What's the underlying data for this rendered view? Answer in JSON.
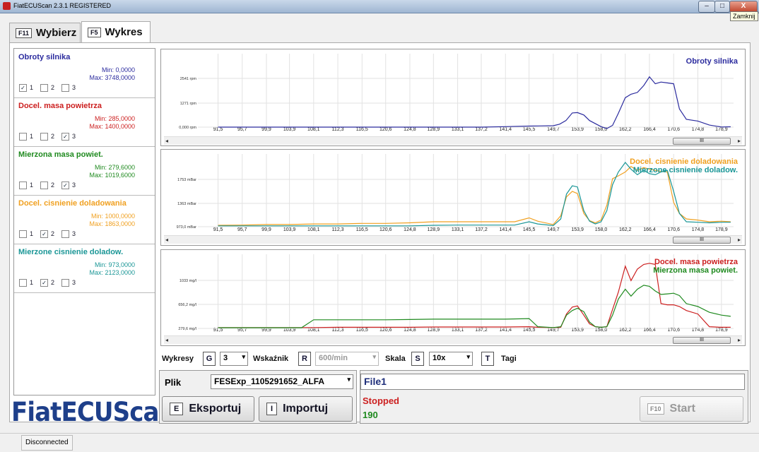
{
  "window": {
    "title": "FiatECUScan 2.3.1 REGISTERED",
    "close_tooltip": "Zamknij",
    "min_label": "–",
    "max_label": "□",
    "close_label": "X"
  },
  "tabs": [
    {
      "key": "F11",
      "label": "Wybierz"
    },
    {
      "key": "F5",
      "label": "Wykres"
    }
  ],
  "signals": [
    {
      "name": "Obroty silnika",
      "color": "#2b2b9e",
      "min": "Min: 0,0000",
      "max": "Max: 3748,0000",
      "checked": [
        true,
        false,
        false
      ]
    },
    {
      "name": "Docel. masa powietrza",
      "color": "#cc1f1f",
      "min": "Min: 285,0000",
      "max": "Max: 1400,0000",
      "checked": [
        false,
        false,
        true
      ]
    },
    {
      "name": "Mierzona masa powiet.",
      "color": "#1f8a1f",
      "min": "Min: 279,6000",
      "max": "Max: 1019,6000",
      "checked": [
        false,
        false,
        true
      ]
    },
    {
      "name": "Docel. cisnienie doladowania",
      "color": "#f0a020",
      "min": "Min: 1000,0000",
      "max": "Max: 1863,0000",
      "checked": [
        false,
        true,
        false
      ]
    },
    {
      "name": "Mierzone cisnienie doladow.",
      "color": "#1a9696",
      "min": "Min: 973,0000",
      "max": "Max: 2123,0000",
      "checked": [
        false,
        true,
        false
      ]
    }
  ],
  "check_labels": [
    "1",
    "2",
    "3"
  ],
  "check_mark": "✓",
  "x_ticks": [
    "91,5",
    "95,7",
    "99,9",
    "103,9",
    "108,1",
    "112,3",
    "116,5",
    "120,6",
    "124,8",
    "128,9",
    "133,1",
    "137,2",
    "141,4",
    "145,5",
    "149,7",
    "153,9",
    "158,0",
    "162,2",
    "166,4",
    "170,6",
    "174,8",
    "178,9"
  ],
  "scroll": {
    "left": "◂",
    "right": "▸",
    "thumb": "III"
  },
  "chart_data": [
    {
      "type": "line",
      "y_ticks": [
        "2541 rpm",
        "1271 rpm",
        "0,000 rpm"
      ],
      "x": [
        91.5,
        95.7,
        99.9,
        103.9,
        108.1,
        112.3,
        116.5,
        120.6,
        124.8,
        128.9,
        133.1,
        137.2,
        141.4,
        145.5,
        149.7,
        150.8,
        151.9,
        153.0,
        153.9,
        155.0,
        156.0,
        158.0,
        159.0,
        160.0,
        161.0,
        162.2,
        163.2,
        164.3,
        165.4,
        166.4,
        167.4,
        168.4,
        169.5,
        170.6,
        171.6,
        172.8,
        174.8,
        176.8,
        178.9,
        180.5
      ],
      "series": [
        {
          "name": "Obroty silnika",
          "color": "#2b2b9e",
          "values": [
            0,
            0,
            0,
            0,
            0,
            0,
            0,
            0,
            0,
            0,
            0,
            0,
            30,
            60,
            80,
            170,
            380,
            820,
            840,
            700,
            380,
            30,
            -80,
            100,
            800,
            1700,
            1900,
            2000,
            2400,
            2900,
            2500,
            2600,
            2550,
            2500,
            1050,
            450,
            350,
            120,
            10,
            20
          ]
        }
      ]
    },
    {
      "type": "line",
      "y_ticks": [
        "1753 mBar",
        "1363 mBar",
        "973,0 mBar"
      ],
      "x": [
        91.5,
        95.7,
        99.9,
        103.9,
        108.1,
        112.3,
        116.5,
        120.6,
        124.8,
        128.9,
        133.1,
        137.2,
        141.4,
        143.0,
        145.5,
        147.0,
        149.7,
        151.0,
        152.0,
        153.0,
        153.9,
        155.0,
        156.0,
        157.0,
        158.0,
        159.0,
        160.0,
        161.0,
        162.2,
        163.2,
        164.3,
        165.4,
        166.4,
        167.4,
        168.4,
        169.5,
        170.6,
        171.6,
        172.8,
        174.8,
        176.8,
        178.9,
        180.5
      ],
      "series": [
        {
          "name": "Docel. cisnienie doladowania",
          "color": "#f0a020",
          "values": [
            985,
            990,
            1000,
            1000,
            1010,
            1010,
            1020,
            1020,
            1030,
            1050,
            1050,
            1050,
            1050,
            1050,
            1120,
            1060,
            1000,
            1160,
            1500,
            1600,
            1560,
            1200,
            1070,
            1030,
            1080,
            1350,
            1830,
            1880,
            1950,
            2050,
            1980,
            2030,
            2000,
            1980,
            1960,
            1950,
            1400,
            1200,
            1100,
            1080,
            1050,
            1060,
            1050
          ]
        },
        {
          "name": "Mierzone cisnienie doladow.",
          "color": "#1a9696",
          "values": [
            975,
            975,
            975,
            975,
            975,
            975,
            975,
            975,
            975,
            985,
            990,
            990,
            990,
            990,
            1050,
            1010,
            980,
            1100,
            1550,
            1700,
            1680,
            1250,
            1060,
            1010,
            1050,
            1250,
            1720,
            1950,
            2123,
            2000,
            1900,
            1980,
            1920,
            1900,
            1950,
            1980,
            1600,
            1200,
            1050,
            1040,
            1030,
            1040,
            1040
          ]
        }
      ]
    },
    {
      "type": "line",
      "y_ticks": [
        "1033 mg/l",
        "656,2 mg/l",
        "279,6 mg/l"
      ],
      "x": [
        91.5,
        95.7,
        99.9,
        103.9,
        106.0,
        108.1,
        112.3,
        116.5,
        120.6,
        124.8,
        128.9,
        133.1,
        137.2,
        141.4,
        145.5,
        147.0,
        149.7,
        151.0,
        152.0,
        153.0,
        153.9,
        155.0,
        156.0,
        157.0,
        158.0,
        159.0,
        160.0,
        161.0,
        162.2,
        163.2,
        164.3,
        165.4,
        166.4,
        167.4,
        168.4,
        169.5,
        170.6,
        171.6,
        172.8,
        174.8,
        176.8,
        178.9,
        180.5
      ],
      "series": [
        {
          "name": "Docel. masa powietrza",
          "color": "#cc1f1f",
          "values": [
            285,
            285,
            285,
            285,
            285,
            285,
            290,
            290,
            290,
            290,
            295,
            295,
            295,
            295,
            300,
            290,
            285,
            290,
            520,
            640,
            660,
            500,
            350,
            300,
            290,
            300,
            600,
            900,
            1350,
            1100,
            1300,
            1380,
            1400,
            1380,
            700,
            680,
            680,
            650,
            580,
            520,
            300,
            290,
            290
          ]
        },
        {
          "name": "Mierzona masa powiet.",
          "color": "#1f8a1f",
          "values": [
            282,
            282,
            282,
            282,
            282,
            420,
            420,
            420,
            420,
            425,
            430,
            430,
            430,
            430,
            440,
            300,
            285,
            300,
            500,
            580,
            620,
            560,
            380,
            300,
            290,
            300,
            500,
            780,
            950,
            830,
            950,
            1019,
            1000,
            920,
            860,
            870,
            880,
            840,
            700,
            650,
            550,
            500,
            480
          ]
        }
      ]
    }
  ],
  "chart_legends": [
    [
      "Obroty silnika"
    ],
    [
      "Docel. cisnienie doladowania",
      "Mierzone cisnienie doladow."
    ],
    [
      "Docel. masa powietrza",
      "Mierzona masa powiet."
    ]
  ],
  "controls": {
    "wykresy_label": "Wykresy",
    "wykresy_key": "G",
    "wykresy_value": "3",
    "wskaznik_label": "Wskaźnik",
    "wskaznik_key": "R",
    "wskaznik_value": "600/min",
    "skala_label": "Skala",
    "skala_key": "S",
    "skala_value": "10x",
    "tagi_key": "T",
    "tagi_label": "Tagi",
    "dropdown_arrow": "▾"
  },
  "file": {
    "plik_label": "Plik",
    "plik_value": "FESExp_1105291652_ALFA",
    "export_key": "E",
    "export_label": "Eksportuj",
    "import_key": "I",
    "import_label": "Importuj",
    "file_name": "File1",
    "status": "Stopped",
    "count": "190",
    "start_key": "F10",
    "start_label": "Start"
  },
  "logo": "FiatECUScan",
  "statusbar": {
    "text": "Disconnected"
  }
}
